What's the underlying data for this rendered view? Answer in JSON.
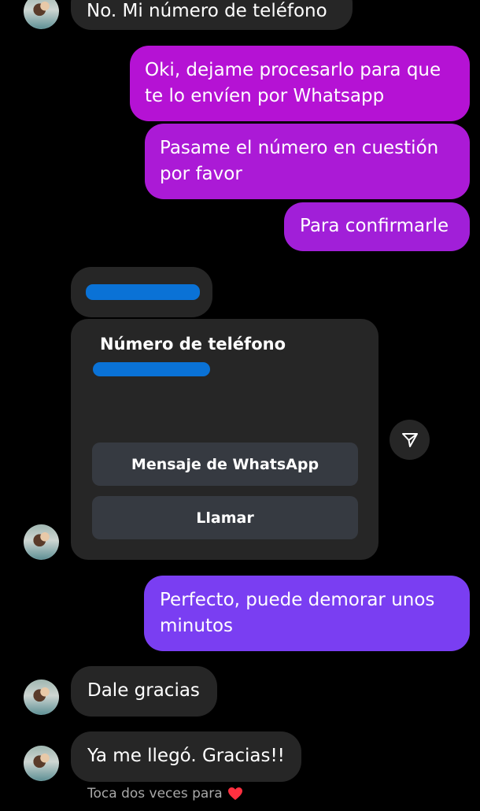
{
  "messages": {
    "top_partial": "No. Mi número de teléfono",
    "out_1": [
      "Oki, dejame procesarlo para que",
      "te lo envíen por Whatsapp"
    ],
    "out_2": [
      "Pasame el número en cuestión",
      "por favor"
    ],
    "out_3": "Para confirmarle",
    "out_4": [
      "Perfecto, puede demorar unos",
      "minutos"
    ],
    "in_1": "Dale gracias",
    "in_2": "Ya me llegó. Gracias!!"
  },
  "contact_card": {
    "title": "Número de teléfono",
    "whatsapp_button": "Mensaje de WhatsApp",
    "call_button": "Llamar"
  },
  "hint_text": "Toca dos veces para",
  "icons": {
    "share": "send-icon",
    "heart": "heart-icon"
  },
  "colors": {
    "background": "#000000",
    "incoming_bubble": "#262626",
    "outgoing_magenta": "#b412d8",
    "outgoing_violet": "#7b3df2",
    "redaction": "#0a72d6",
    "heart": "#ff3040"
  }
}
